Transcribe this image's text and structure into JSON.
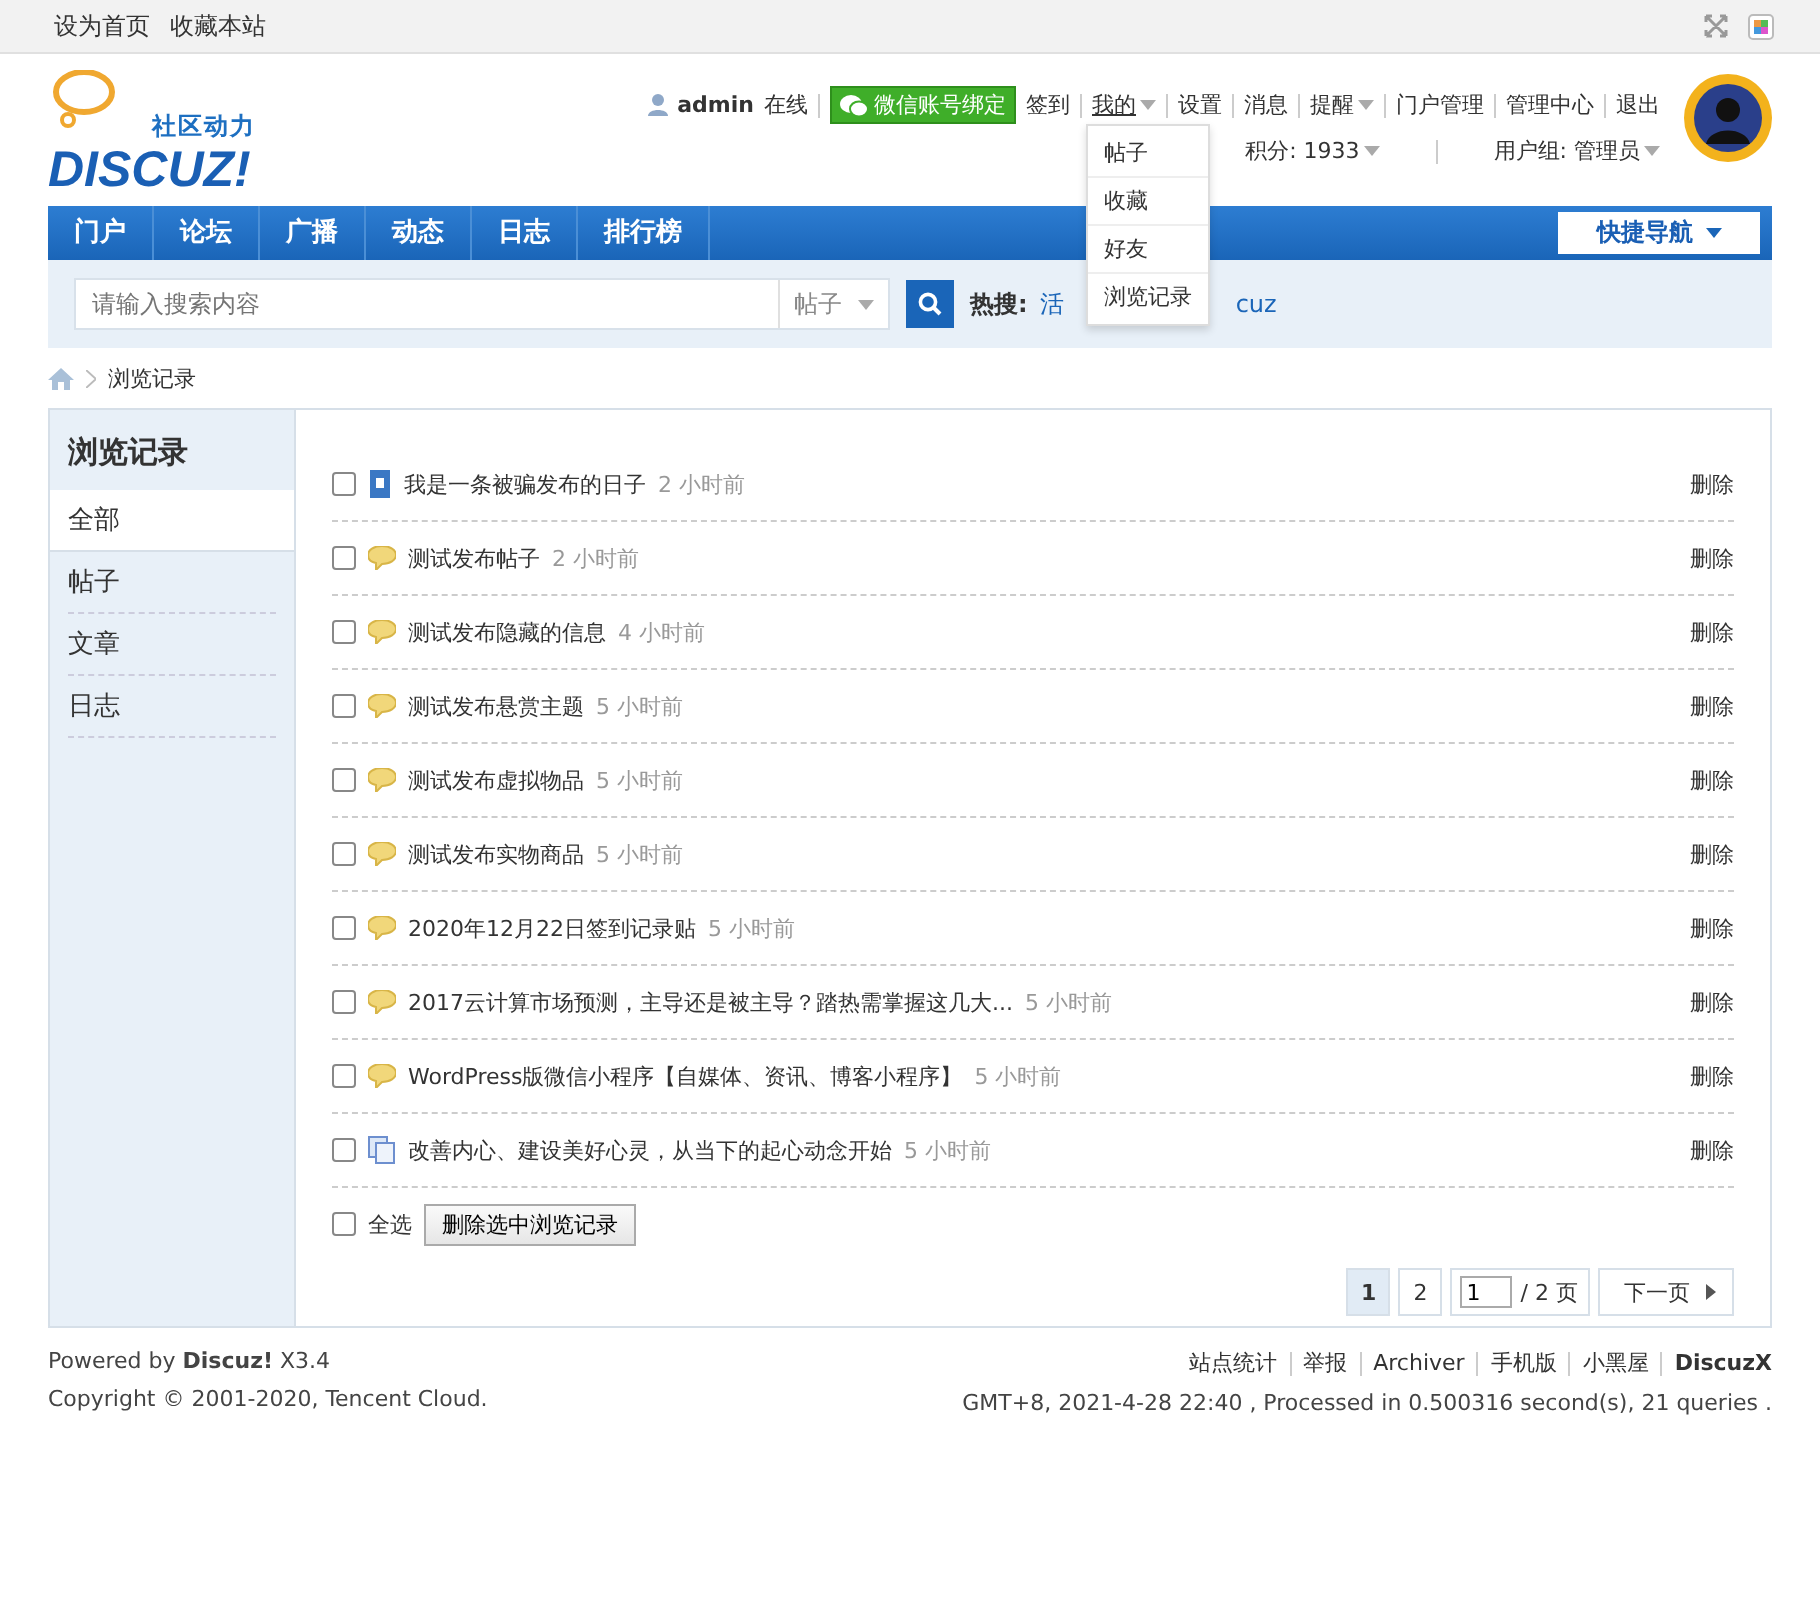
{
  "top_bar": {
    "links": [
      "设为首页",
      "收藏本站"
    ]
  },
  "header": {
    "logo_tagline": "社区动力",
    "logo_text": "DISCUZ!",
    "username": "admin",
    "status": "在线",
    "wechat_button": "微信账号绑定",
    "links": [
      {
        "label": "签到",
        "caret": false,
        "expanded": false
      },
      {
        "label": "我的",
        "caret": true,
        "expanded": true
      },
      {
        "label": "设置",
        "caret": false,
        "expanded": false
      },
      {
        "label": "消息",
        "caret": false,
        "expanded": false
      },
      {
        "label": "提醒",
        "caret": true,
        "expanded": false
      },
      {
        "label": "门户管理",
        "caret": false,
        "expanded": false
      },
      {
        "label": "管理中心",
        "caret": false,
        "expanded": false
      },
      {
        "label": "退出",
        "caret": false,
        "expanded": false
      }
    ],
    "dropdown": [
      "帖子",
      "收藏",
      "好友",
      "浏览记录"
    ],
    "points": "积分: 1933",
    "usergroup": "用户组: 管理员"
  },
  "nav": {
    "items": [
      "门户",
      "论坛",
      "广播",
      "动态",
      "日志",
      "排行榜"
    ],
    "quick_nav": "快捷导航"
  },
  "search": {
    "placeholder": "请输入搜索内容",
    "type": "帖子",
    "hot_label": "热搜:",
    "hot_fragments": [
      "活",
      "cuz"
    ]
  },
  "breadcrumb": "浏览记录",
  "sidebar": {
    "title": "浏览记录",
    "items": [
      {
        "label": "全部",
        "selected": true
      },
      {
        "label": "帖子",
        "selected": false
      },
      {
        "label": "文章",
        "selected": false
      },
      {
        "label": "日志",
        "selected": false
      }
    ]
  },
  "rows": [
    {
      "kind": "doc",
      "title": "我是一条被骗发布的日子",
      "time": "2 小时前",
      "checked": false,
      "action": "删除"
    },
    {
      "kind": "bubble",
      "title": "测试发布帖子",
      "time": "2 小时前",
      "checked": false,
      "action": "删除"
    },
    {
      "kind": "bubble",
      "title": "测试发布隐藏的信息",
      "time": "4 小时前",
      "checked": false,
      "action": "删除"
    },
    {
      "kind": "bubble",
      "title": "测试发布悬赏主题",
      "time": "5 小时前",
      "checked": false,
      "action": "删除"
    },
    {
      "kind": "bubble",
      "title": "测试发布虚拟物品",
      "time": "5 小时前",
      "checked": false,
      "action": "删除"
    },
    {
      "kind": "bubble",
      "title": "测试发布实物商品",
      "time": "5 小时前",
      "checked": false,
      "action": "删除"
    },
    {
      "kind": "bubble",
      "title": "2020年12月22日签到记录贴",
      "time": "5 小时前",
      "checked": false,
      "action": "删除"
    },
    {
      "kind": "bubble",
      "title": "2017云计算市场预测，主导还是被主导？踏热需掌握这几大...",
      "time": "5 小时前",
      "checked": false,
      "action": "删除"
    },
    {
      "kind": "bubble",
      "title": "WordPress版微信小程序【自媒体、资讯、博客小程序】",
      "time": "5 小时前",
      "checked": false,
      "action": "删除"
    },
    {
      "kind": "pages",
      "title": "改善内心、建设美好心灵，从当下的起心动念开始",
      "time": "5 小时前",
      "checked": false,
      "action": "删除"
    }
  ],
  "bulk": {
    "select_all": "全选",
    "checked": false,
    "delete_button": "删除选中浏览记录"
  },
  "pagination": {
    "pages": [
      {
        "label": "1",
        "selected": true
      },
      {
        "label": "2",
        "selected": false
      }
    ],
    "page_input": "1",
    "total": "/ 2 页",
    "next": "下一页"
  },
  "footer": {
    "powered_prefix": "Powered by",
    "powered_brand": "Discuz!",
    "version": "X3.4",
    "copyright": "Copyright © 2001-2020, Tencent Cloud.",
    "links": [
      {
        "label": "站点统计",
        "bold": false
      },
      {
        "label": "举报",
        "bold": false
      },
      {
        "label": "Archiver",
        "bold": false
      },
      {
        "label": "手机版",
        "bold": false
      },
      {
        "label": "小黑屋",
        "bold": false
      },
      {
        "label": "DiscuzX",
        "bold": true
      }
    ],
    "stats": "GMT+8, 2021-4-28 22:40 , Processed in 0.500316 second(s), 21 queries ."
  }
}
